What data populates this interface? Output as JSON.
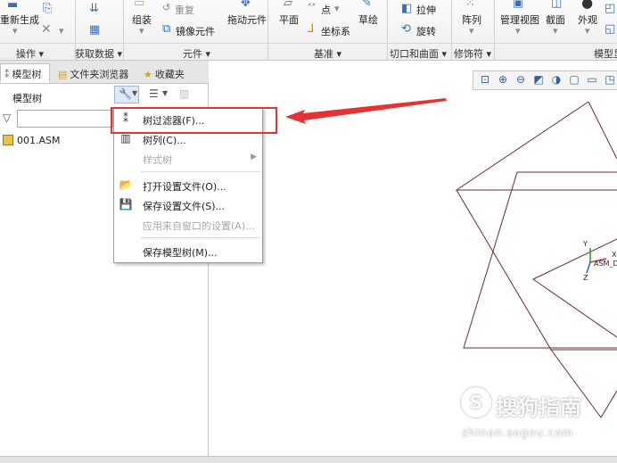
{
  "ribbon": {
    "regenerate_label": "重新生成",
    "assemble_label": "组装",
    "redo_label": "重复",
    "mirror_component_label": "镜像元件",
    "drag_component_label": "拖动元件",
    "plane_label": "平面",
    "point_label": "点",
    "coordinate_system_label": "坐标系",
    "sketch_label": "草绘",
    "extrude_label": "拉伸",
    "revolve_label": "旋转",
    "pattern_label": "阵列",
    "manage_views_label": "管理视图",
    "section_label": "截面",
    "appearance_label": "外观",
    "groups": {
      "operations": "操作",
      "get_data": "获取数据",
      "component": "元件",
      "datum": "基准",
      "cut_surface": "切口和曲面",
      "modifiers": "修饰符",
      "model_display": "模型显"
    }
  },
  "left_panel": {
    "tabs": [
      "模型树",
      "文件夹浏览器",
      "收藏夹"
    ],
    "tree_header": "模型树",
    "filter_placeholder": "",
    "tree_items": [
      "001.ASM"
    ]
  },
  "context_menu": {
    "items": [
      {
        "label": "树过滤器(F)...",
        "icon": "tree-filter-icon",
        "enabled": true
      },
      {
        "label": "树列(C)...",
        "icon": "tree-columns-icon",
        "enabled": true
      },
      {
        "label": "样式树",
        "icon": "",
        "enabled": false,
        "submenu": true
      },
      {
        "label": "打开设置文件(O)...",
        "icon": "folder-open-icon",
        "enabled": true
      },
      {
        "label": "保存设置文件(S)...",
        "icon": "floppy-disk-icon",
        "enabled": true
      },
      {
        "label": "应用来自窗口的设置(A)...",
        "icon": "",
        "enabled": false
      },
      {
        "label": "保存模型树(M)...",
        "icon": "",
        "enabled": true
      }
    ]
  },
  "viewport": {
    "axis_y": "Y",
    "axis_x": "X",
    "axis_z": "Z",
    "csys_label": "ASM_D"
  },
  "watermark": {
    "brand": "搜狗指南",
    "url": "zhinan.sogou.com"
  },
  "colors": {
    "highlight": "#e53232",
    "sketch_lines": "#6b2c2c",
    "accent": "#3a6fb0"
  }
}
